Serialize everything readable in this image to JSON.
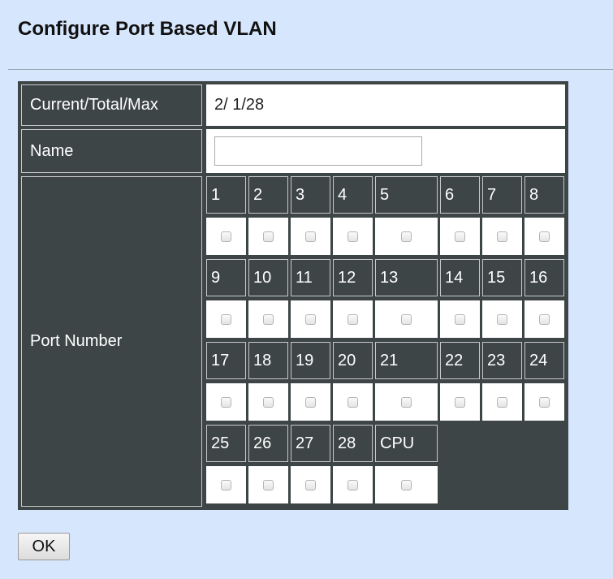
{
  "page": {
    "title": "Configure Port Based VLAN"
  },
  "form": {
    "current_label": "Current/Total/Max",
    "current_value": "2/ 1/28",
    "name_label": "Name",
    "name_value": "",
    "name_placeholder": "",
    "port_label": "Port Number"
  },
  "ports": {
    "rows": [
      [
        {
          "label": "1",
          "checked": false
        },
        {
          "label": "2",
          "checked": false
        },
        {
          "label": "3",
          "checked": false
        },
        {
          "label": "4",
          "checked": false
        },
        {
          "label": "5",
          "checked": false
        },
        {
          "label": "6",
          "checked": false
        },
        {
          "label": "7",
          "checked": false
        },
        {
          "label": "8",
          "checked": false
        }
      ],
      [
        {
          "label": "9",
          "checked": false
        },
        {
          "label": "10",
          "checked": false
        },
        {
          "label": "11",
          "checked": false
        },
        {
          "label": "12",
          "checked": false
        },
        {
          "label": "13",
          "checked": false
        },
        {
          "label": "14",
          "checked": false
        },
        {
          "label": "15",
          "checked": false
        },
        {
          "label": "16",
          "checked": false
        }
      ],
      [
        {
          "label": "17",
          "checked": false
        },
        {
          "label": "18",
          "checked": false
        },
        {
          "label": "19",
          "checked": false
        },
        {
          "label": "20",
          "checked": false
        },
        {
          "label": "21",
          "checked": false
        },
        {
          "label": "22",
          "checked": false
        },
        {
          "label": "23",
          "checked": false
        },
        {
          "label": "24",
          "checked": false
        }
      ],
      [
        {
          "label": "25",
          "checked": false
        },
        {
          "label": "26",
          "checked": false
        },
        {
          "label": "27",
          "checked": false
        },
        {
          "label": "28",
          "checked": false
        },
        {
          "label": "CPU",
          "checked": false
        }
      ]
    ]
  },
  "buttons": {
    "ok_label": "OK"
  }
}
